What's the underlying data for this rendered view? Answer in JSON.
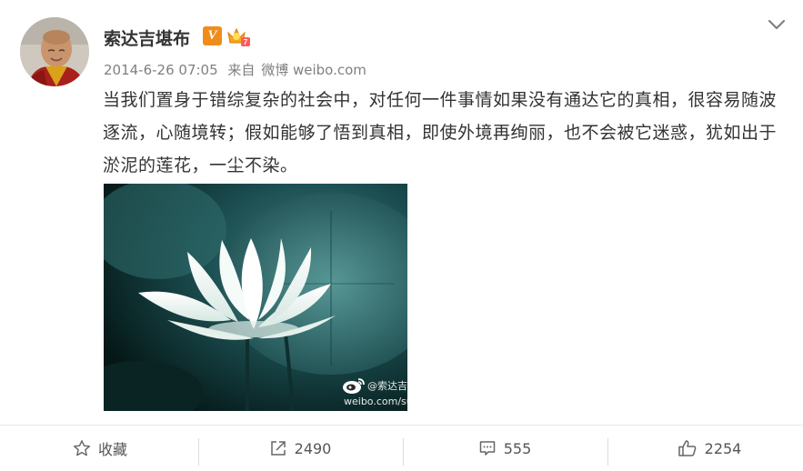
{
  "post": {
    "username": "索达吉堪布",
    "verified_badge": "V",
    "level_badge_icon": "crown-level-badge-icon",
    "timestamp": "2014-6-26 07:05",
    "source_prefix": "来自",
    "source": "微博 weibo.com",
    "text": "当我们置身于错综复杂的社会中，对任何一件事情如果没有通达它的真相，很容易随波逐流，心随境转；假如能够了悟到真相，即使外境再绚丽，也不会被它迷惑，犹如出于淤泥的莲花，一尘不染。",
    "image": {
      "subject": "white-lotus-photo",
      "watermark_name": "@索达吉堪",
      "watermark_url": "weibo.com/su"
    }
  },
  "menu_icon": "chevron-down-icon",
  "actions": {
    "favorite": {
      "label": "收藏",
      "icon": "star-icon"
    },
    "repost": {
      "count": "2490",
      "icon": "share-icon"
    },
    "comment": {
      "count": "555",
      "icon": "comment-icon"
    },
    "like": {
      "count": "2254",
      "icon": "thumbs-up-icon"
    }
  },
  "colors": {
    "verified": "#f08c1a",
    "text": "#333333",
    "meta": "#808080"
  }
}
